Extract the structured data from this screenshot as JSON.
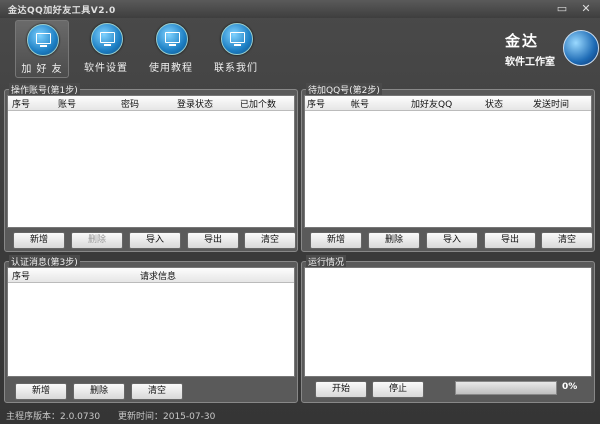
{
  "window": {
    "title": "金达QQ加好友工具V2.0",
    "min": "▭",
    "close": "✕"
  },
  "toolbar": [
    {
      "label": "加 好 友"
    },
    {
      "label": "软件设置"
    },
    {
      "label": "使用教程"
    },
    {
      "label": "联系我们"
    }
  ],
  "logo": {
    "brand": "金达",
    "sub": "软件工作室"
  },
  "accounts": {
    "title": "操作账号(第1步)",
    "columns": [
      "序号",
      "账号",
      "密码",
      "登录状态",
      "已加个数"
    ],
    "buttons": {
      "add": "新增",
      "delete": "删除",
      "import": "导入",
      "export": "导出",
      "clear": "清空"
    }
  },
  "pending": {
    "title": "待加QQ号(第2步)",
    "columns": [
      "序号",
      "帐号",
      "加好友QQ",
      "状态",
      "发送时间"
    ],
    "buttons": {
      "add": "新增",
      "delete": "删除",
      "import": "导入",
      "export": "导出",
      "clear": "清空"
    }
  },
  "verify": {
    "title": "认证消息(第3步)",
    "columns": [
      "序号",
      "请求信息"
    ],
    "buttons": {
      "add": "新增",
      "delete": "删除",
      "clear": "清空"
    }
  },
  "run": {
    "title": "运行情况",
    "start": "开始",
    "stop": "停止",
    "progress_percent": 0,
    "progress_label": "0%"
  },
  "status": {
    "version": "主程序版本：2.0.0730",
    "updated": "更新时间：2015-07-30"
  }
}
